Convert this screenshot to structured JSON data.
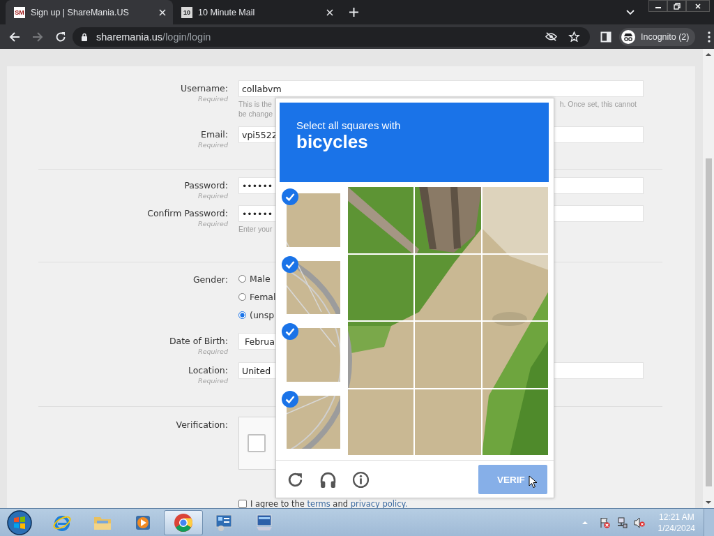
{
  "browser": {
    "tabs": [
      {
        "favicon": "SM",
        "title": "Sign up | ShareMania.US",
        "selected": true
      },
      {
        "favicon": "10",
        "title": "10 Minute Mail",
        "selected": false
      }
    ],
    "url": {
      "host": "sharemania.us",
      "path": "/login/login"
    },
    "profile": "Incognito (2)"
  },
  "form": {
    "sections": [
      {
        "rows": [
          {
            "kind": "text",
            "label": "Username:",
            "required": "Required",
            "value": "collabvm",
            "hint_left": [
              "This is the",
              "be change"
            ],
            "hint_right": "h. Once set, this cannot"
          },
          {
            "kind": "text",
            "label": "Email:",
            "required": "Required",
            "value": "vpi5522"
          }
        ]
      },
      {
        "rows": [
          {
            "kind": "text",
            "label": "Password:",
            "required": "Required",
            "value": "••••••"
          },
          {
            "kind": "text",
            "label": "Confirm Password:",
            "required": "Required",
            "value": "••••••",
            "hint_left": [
              "Enter your"
            ]
          }
        ]
      },
      {
        "rows": [
          {
            "kind": "radio",
            "label": "Gender:",
            "options": [
              {
                "label": "Male",
                "selected": false
              },
              {
                "label": "Femal",
                "selected": false
              },
              {
                "label": "(unsp",
                "selected": true
              }
            ]
          },
          {
            "kind": "select",
            "label": "Date of Birth:",
            "required": "Required",
            "value": "Februa"
          },
          {
            "kind": "text",
            "label": "Location:",
            "required": "Required",
            "value": "United"
          }
        ]
      },
      {
        "rows": [
          {
            "kind": "recaptcha",
            "label": "Verification:",
            "checked": false
          }
        ]
      }
    ],
    "agree": {
      "checked": false,
      "before": "I agree to the",
      "terms": "terms",
      "middle": "and",
      "privacy": "privacy policy."
    }
  },
  "captcha": {
    "prompt": "Select all squares with",
    "keyword": "bicycles",
    "tiles": [
      {
        "selected": true
      },
      {
        "selected": false
      },
      {
        "selected": false
      },
      {
        "selected": false
      },
      {
        "selected": true
      },
      {
        "selected": false
      },
      {
        "selected": false
      },
      {
        "selected": false
      },
      {
        "selected": true
      },
      {
        "selected": false
      },
      {
        "selected": false
      },
      {
        "selected": false
      },
      {
        "selected": true
      },
      {
        "selected": false
      },
      {
        "selected": false
      },
      {
        "selected": false
      }
    ],
    "button": "VERIF"
  },
  "taskbar": {
    "apps": [
      {
        "kind": "ie",
        "selected": false
      },
      {
        "kind": "folder",
        "selected": false
      },
      {
        "kind": "media",
        "selected": false
      },
      {
        "kind": "chrome",
        "selected": true
      },
      {
        "kind": "panel",
        "selected": false
      },
      {
        "kind": "monitor",
        "selected": false
      }
    ],
    "time": "12:21 AM",
    "date": "1/24/2024"
  }
}
